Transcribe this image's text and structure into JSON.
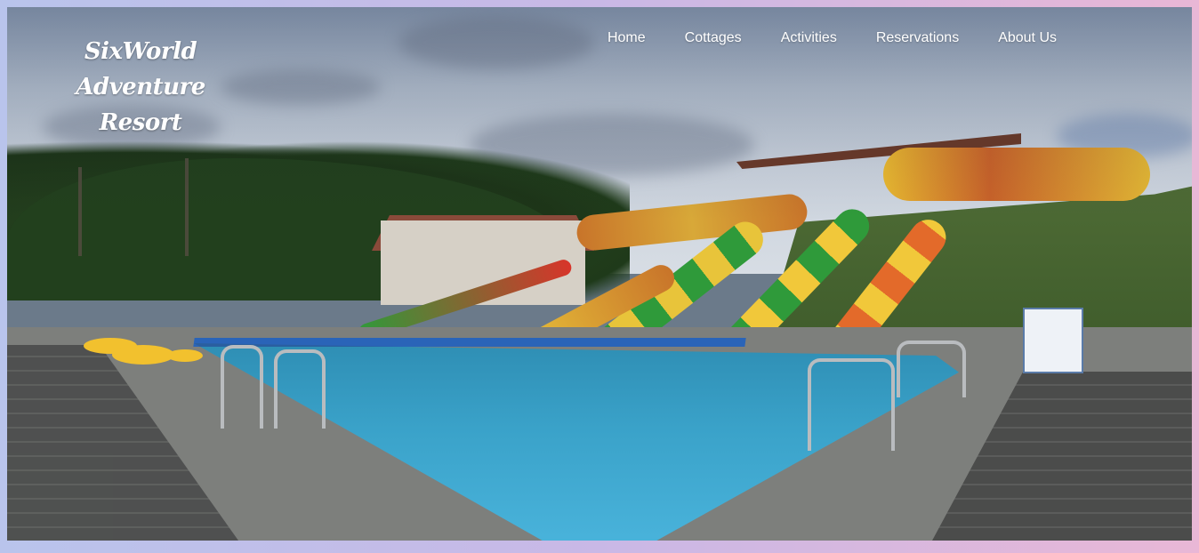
{
  "brand": {
    "line1": "SixWorld Adventure",
    "line2": "Resort"
  },
  "nav": {
    "items": [
      {
        "label": "Home"
      },
      {
        "label": "Cottages"
      },
      {
        "label": "Activities"
      },
      {
        "label": "Reservations"
      },
      {
        "label": "About Us"
      }
    ]
  },
  "hero": {
    "image_description_icon": "waterpark-pool-hero-image"
  },
  "colors": {
    "nav_text": "#ffffff",
    "page_background_start": "#b9c4ec",
    "page_background_end": "#e9b7d6"
  }
}
